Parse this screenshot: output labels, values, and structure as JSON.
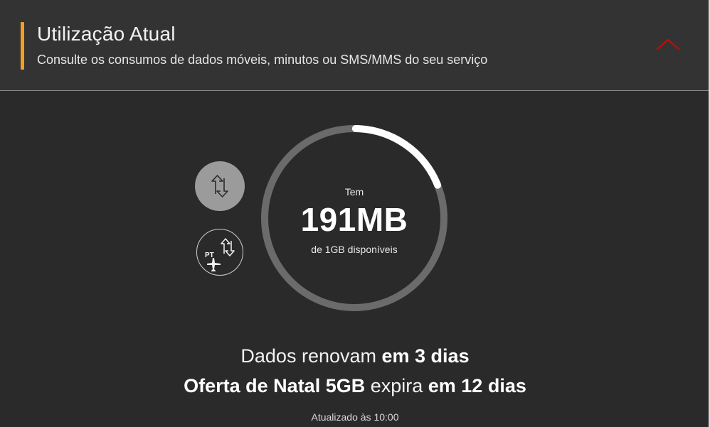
{
  "header": {
    "title": "Utilização Atual",
    "subtitle": "Consulte os consumos de dados móveis, minutos ou SMS/MMS do seu serviço",
    "accent_color": "#f0a01e",
    "collapse_icon": "chevron-up-icon",
    "collapse_color": "#e60000"
  },
  "side_buttons": [
    {
      "icon": "data-transfer-icon",
      "active": true
    },
    {
      "icon": "roaming-data-icon",
      "badge": "PT",
      "active": false
    }
  ],
  "gauge": {
    "label_top": "Tem",
    "value": "191MB",
    "label_bottom": "de 1GB disponíveis",
    "fraction_remaining": 0.19,
    "track_color": "#6b6b6b",
    "fill_color": "#ffffff"
  },
  "renewal": {
    "prefix": "Dados renovam ",
    "emphasis": "em 3 dias"
  },
  "offer": {
    "name": "Oferta de Natal 5GB",
    "middle": " expira ",
    "emphasis": "em 12 dias"
  },
  "updated": "Atualizado às 10:00"
}
